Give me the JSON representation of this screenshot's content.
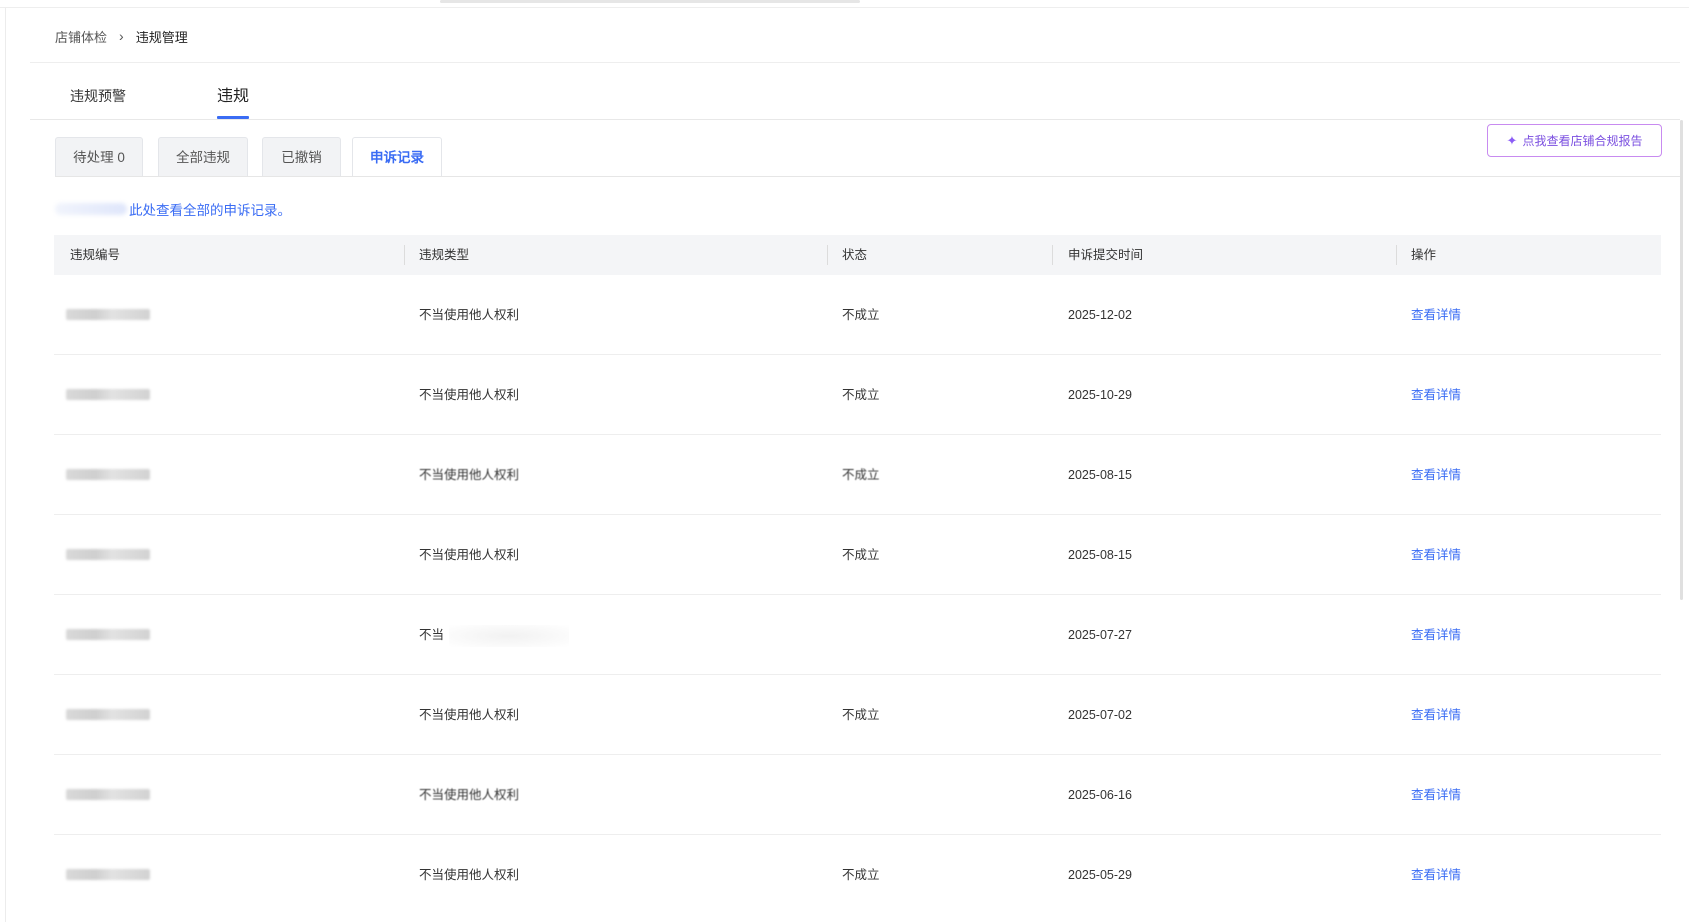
{
  "breadcrumb": {
    "parent": "店铺体检",
    "separator": "›",
    "current": "违规管理"
  },
  "main_tabs": [
    {
      "label": "违规预警",
      "active": false
    },
    {
      "label": "违规",
      "active": true
    }
  ],
  "sub_tabs": [
    {
      "label": "待处理 0",
      "active": false
    },
    {
      "label": "全部违规",
      "active": false
    },
    {
      "label": "已撤销",
      "active": false
    },
    {
      "label": "申诉记录",
      "active": true
    }
  ],
  "report_button": {
    "icon": "sparkle-icon",
    "label": "点我查看店铺合规报告"
  },
  "notice": {
    "text": "此处查看全部的申诉记录。"
  },
  "table": {
    "headers": [
      "违规编号",
      "违规类型",
      "状态",
      "申诉提交时间",
      "操作"
    ],
    "rows": [
      {
        "type": "不当使用他人权利",
        "status": "不成立",
        "submitted": "2025-12-02",
        "action": "查看详情"
      },
      {
        "type": "不当使用他人权利",
        "status": "不成立",
        "submitted": "2025-10-29",
        "action": "查看详情"
      },
      {
        "type": "不当使用他人权利",
        "status": "不成立",
        "submitted": "2025-08-15",
        "action": "查看详情"
      },
      {
        "type": "不当使用他人权利",
        "status": "不成立",
        "submitted": "2025-08-15",
        "action": "查看详情"
      },
      {
        "type": "不当",
        "status": "",
        "submitted": "2025-07-27",
        "action": "查看详情"
      },
      {
        "type": "不当使用他人权利",
        "status": "不成立",
        "submitted": "2025-07-02",
        "action": "查看详情"
      },
      {
        "type": "不当使用他人权利",
        "status": "",
        "submitted": "2025-06-16",
        "action": "查看详情"
      },
      {
        "type": "不当使用他人权利",
        "status": "不成立",
        "submitted": "2025-05-29",
        "action": "查看详情"
      }
    ]
  },
  "colors": {
    "accent": "#3a6cf4",
    "report_border": "#c88bf0",
    "report_text": "#7b4fe0",
    "header_bg": "#f4f5f7"
  }
}
